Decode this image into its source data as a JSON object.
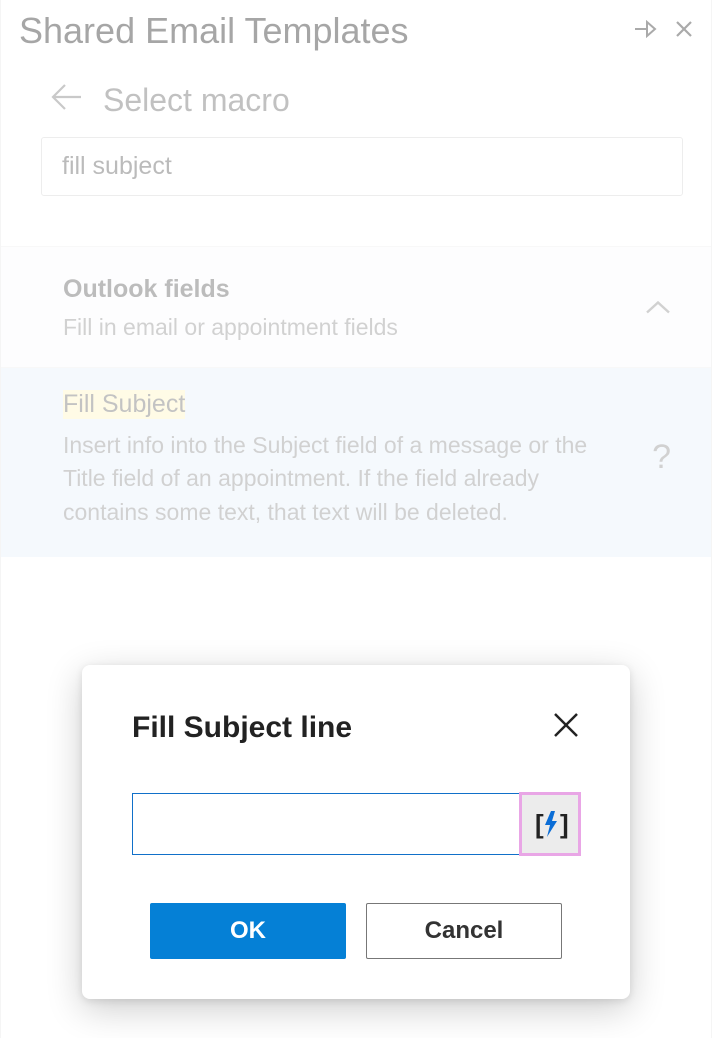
{
  "app_title": "Shared Email Templates",
  "page_title": "Select macro",
  "search": {
    "value": "fill subject"
  },
  "group": {
    "title": "Outlook fields",
    "description": "Fill in email or appointment fields"
  },
  "macro": {
    "title": "Fill Subject",
    "description": "Insert info into the Subject field of a message or the Title field of an appointment. If the field already contains some text, that text will be deleted."
  },
  "dialog": {
    "title": "Fill Subject line",
    "input_value": "",
    "ok_label": "OK",
    "cancel_label": "Cancel"
  }
}
